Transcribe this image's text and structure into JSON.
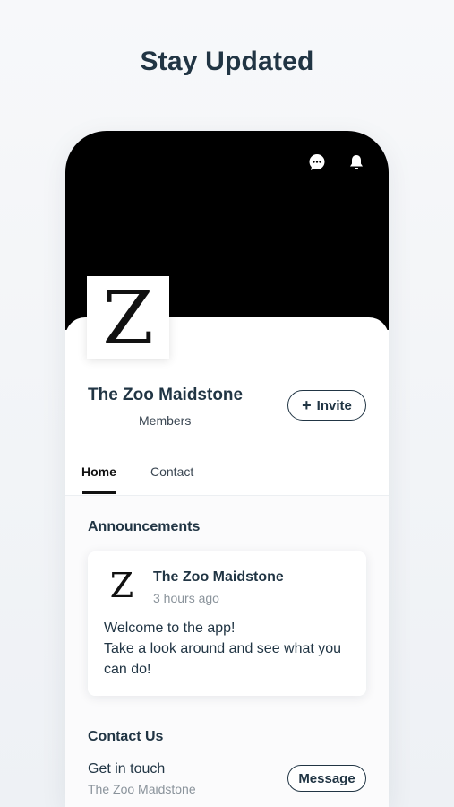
{
  "headline": "Stay Updated",
  "header": {
    "icons": [
      "chat-icon",
      "bell-icon"
    ]
  },
  "group": {
    "logo_letter": "Z",
    "name": "The Zoo Maidstone",
    "members_label": "Members",
    "invite_label": "Invite",
    "invite_icon": "+"
  },
  "tabs": [
    {
      "label": "Home",
      "active": true
    },
    {
      "label": "Contact",
      "active": false
    }
  ],
  "announcements": {
    "title": "Announcements",
    "post": {
      "avatar_letter": "Z",
      "author": "The Zoo Maidstone",
      "time": "3 hours ago",
      "body_lines": [
        "Welcome to the app!",
        "Take a look around and see what you",
        "can do!"
      ]
    }
  },
  "contact": {
    "title": "Contact Us",
    "get_in_touch": "Get in touch",
    "subtitle": "The Zoo Maidstone",
    "message_label": "Message"
  },
  "colors": {
    "primary_text": "#213544",
    "cover": "#000000",
    "muted": "#8a939b"
  }
}
